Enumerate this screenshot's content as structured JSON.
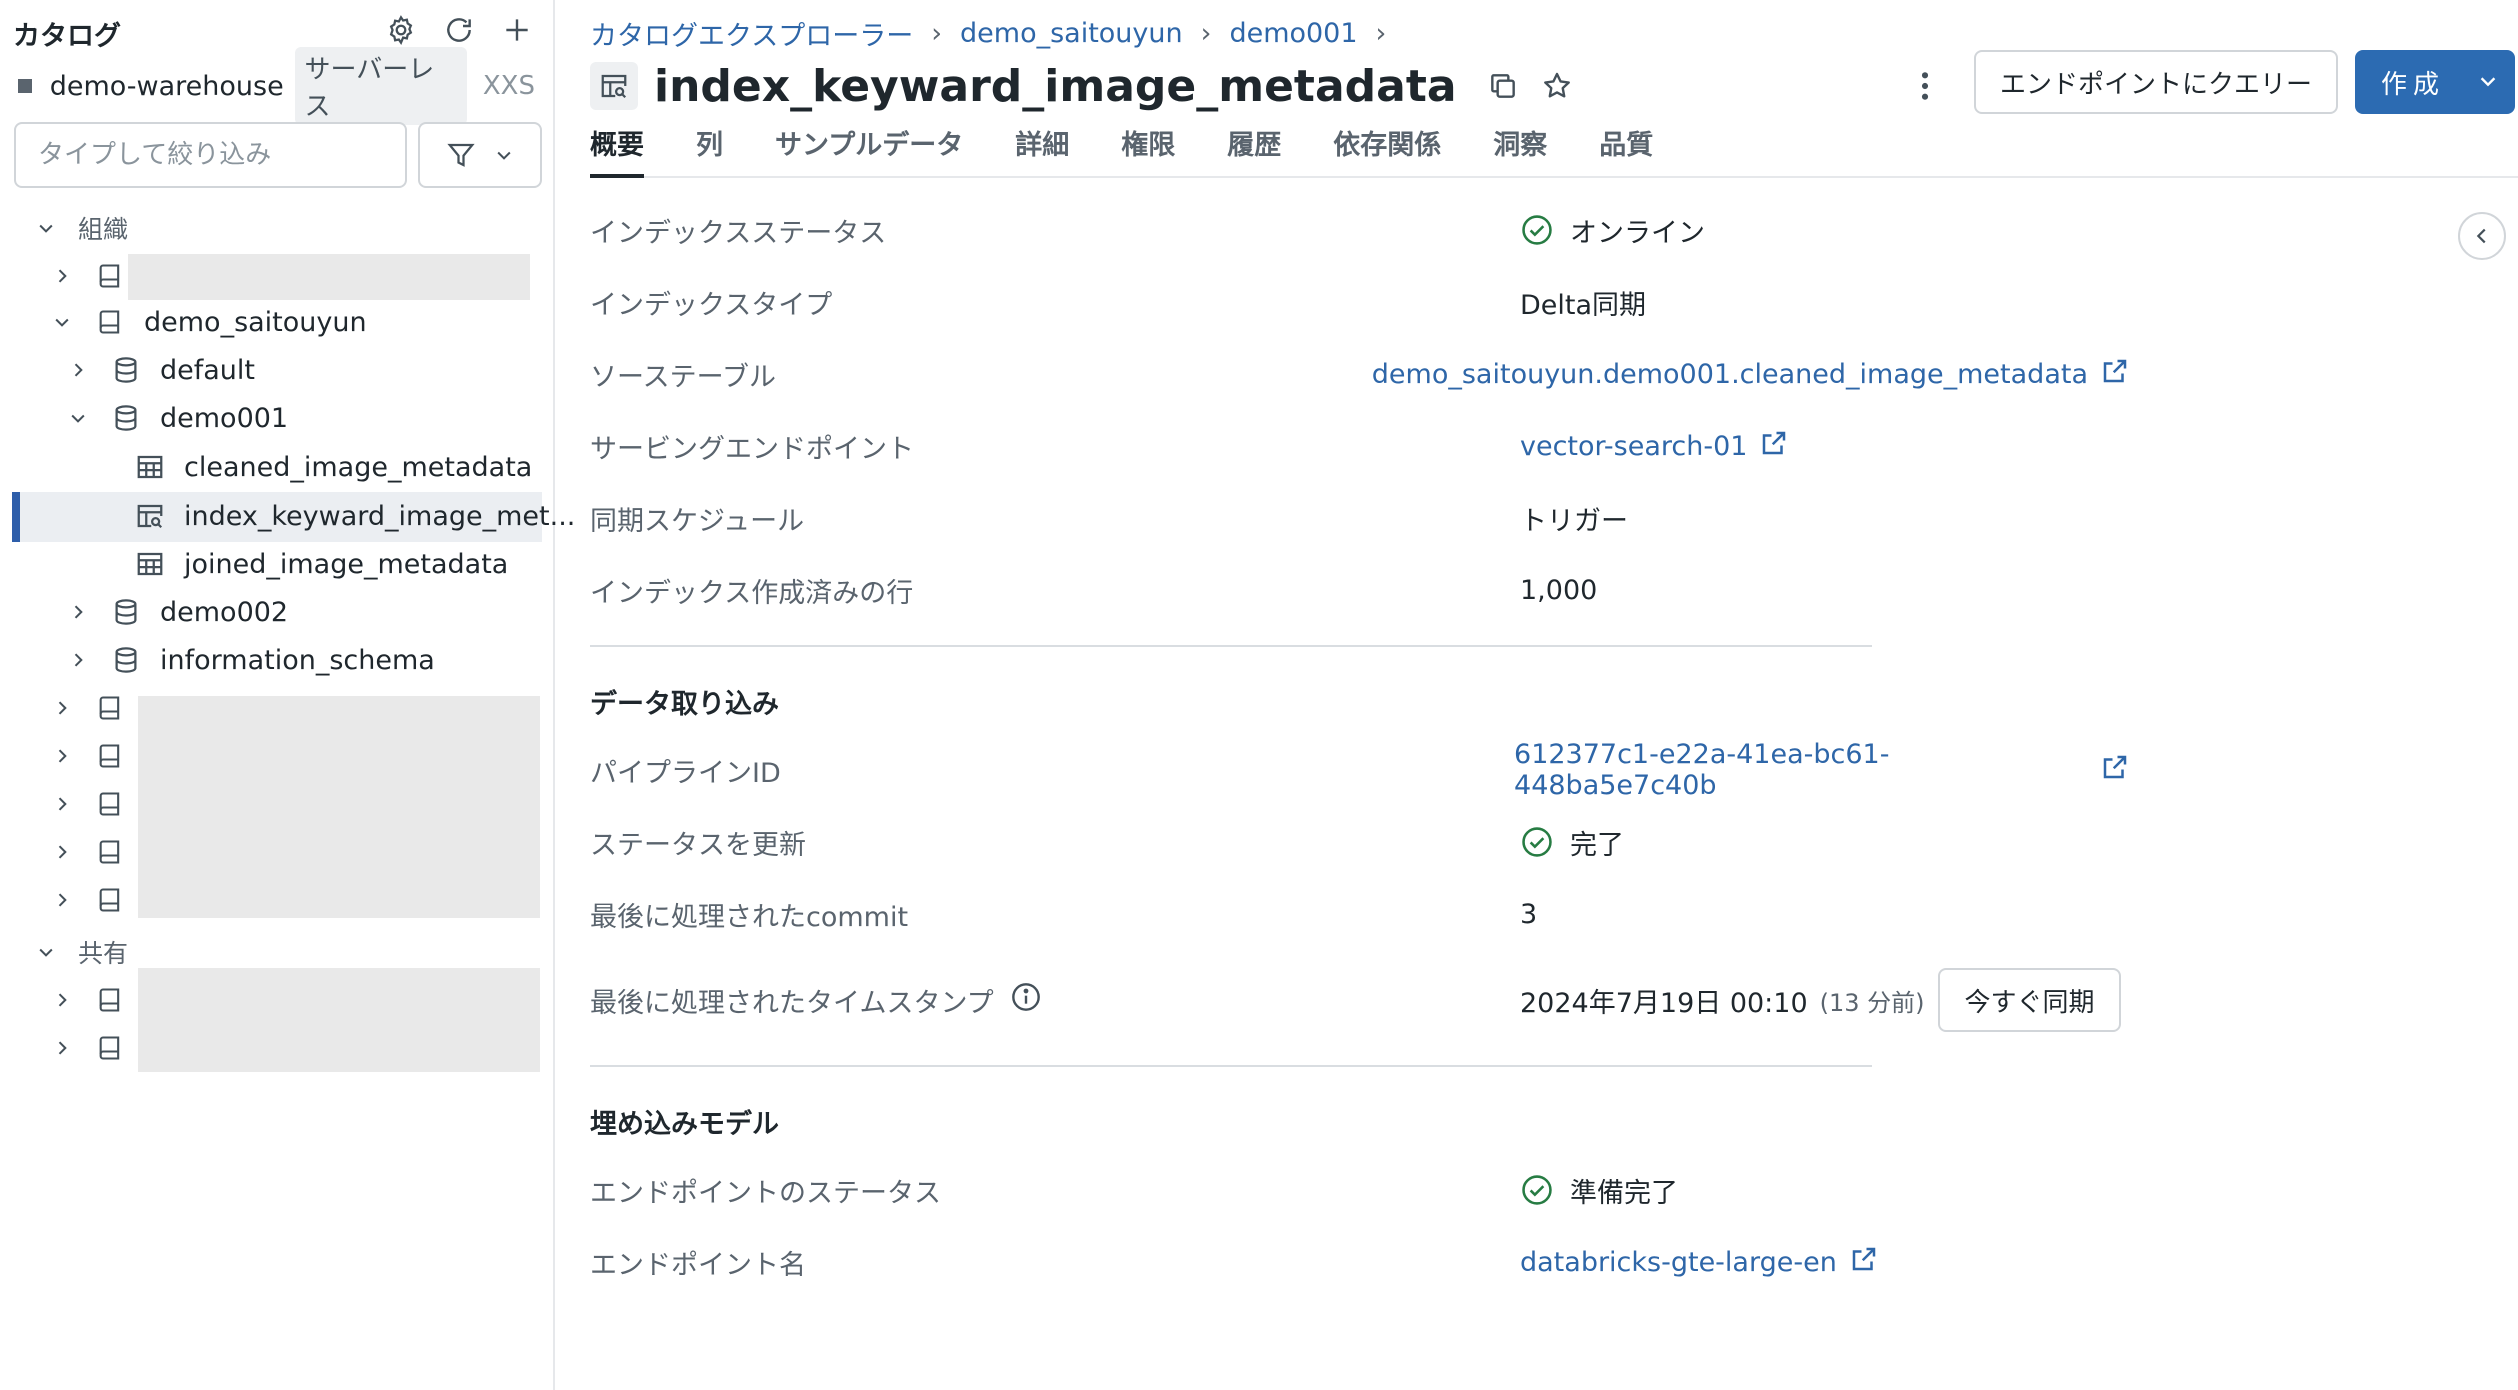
{
  "sidebar": {
    "title": "カタログ",
    "warehouse": {
      "name": "demo-warehouse...",
      "badge": "サーバーレス",
      "size": "XXS"
    },
    "filter_placeholder": "タイプして絞り込み",
    "groups": {
      "org": "組織",
      "shared": "共有"
    },
    "tree": {
      "catalog": "demo_saitouyun",
      "schema_default": "default",
      "schema_demo001": "demo001",
      "table_cleaned": "cleaned_image_metadata",
      "table_index": "index_keyward_image_met...",
      "table_joined": "joined_image_metadata",
      "schema_demo002": "demo002",
      "schema_info": "information_schema"
    }
  },
  "breadcrumb": [
    "カタログエクスプローラー",
    "demo_saitouyun",
    "demo001"
  ],
  "page_title": "index_keyward_image_metadata",
  "header": {
    "query_button": "エンドポイントにクエリー",
    "create_button": "作成"
  },
  "tabs": [
    "概要",
    "列",
    "サンプルデータ",
    "詳細",
    "権限",
    "履歴",
    "依存関係",
    "洞察",
    "品質"
  ],
  "overview": {
    "index_status_label": "インデックスステータス",
    "index_status_value": "オンライン",
    "index_type_label": "インデックスタイプ",
    "index_type_value": "Delta同期",
    "source_table_label": "ソーステーブル",
    "source_table_value": "demo_saitouyun.demo001.cleaned_image_metadata",
    "serving_endpoint_label": "サービングエンドポイント",
    "serving_endpoint_value": "vector-search-01",
    "sync_schedule_label": "同期スケジュール",
    "sync_schedule_value": "トリガー",
    "indexed_rows_label": "インデックス作成済みの行",
    "indexed_rows_value": "1,000"
  },
  "ingestion": {
    "section_title": "データ取り込み",
    "pipeline_id_label": "パイプラインID",
    "pipeline_id_value": "612377c1-e22a-41ea-bc61-448ba5e7c40b",
    "update_status_label": "ステータスを更新",
    "update_status_value": "完了",
    "last_commit_label": "最後に処理されたcommit",
    "last_commit_value": "3",
    "last_timestamp_label": "最後に処理されたタイムスタンプ",
    "last_timestamp_value": "2024年7月19日 00:10",
    "last_timestamp_relative": "(13 分前)",
    "sync_now_button": "今すぐ同期"
  },
  "embedding": {
    "section_title": "埋め込みモデル",
    "endpoint_status_label": "エンドポイントのステータス",
    "endpoint_status_value": "準備完了",
    "endpoint_name_label": "エンドポイント名",
    "endpoint_name_value": "databricks-gte-large-en"
  },
  "colors": {
    "accent": "#2c6bb2",
    "link": "#2e66a8",
    "success": "#277c43",
    "selected_bg": "#ebeef2"
  }
}
